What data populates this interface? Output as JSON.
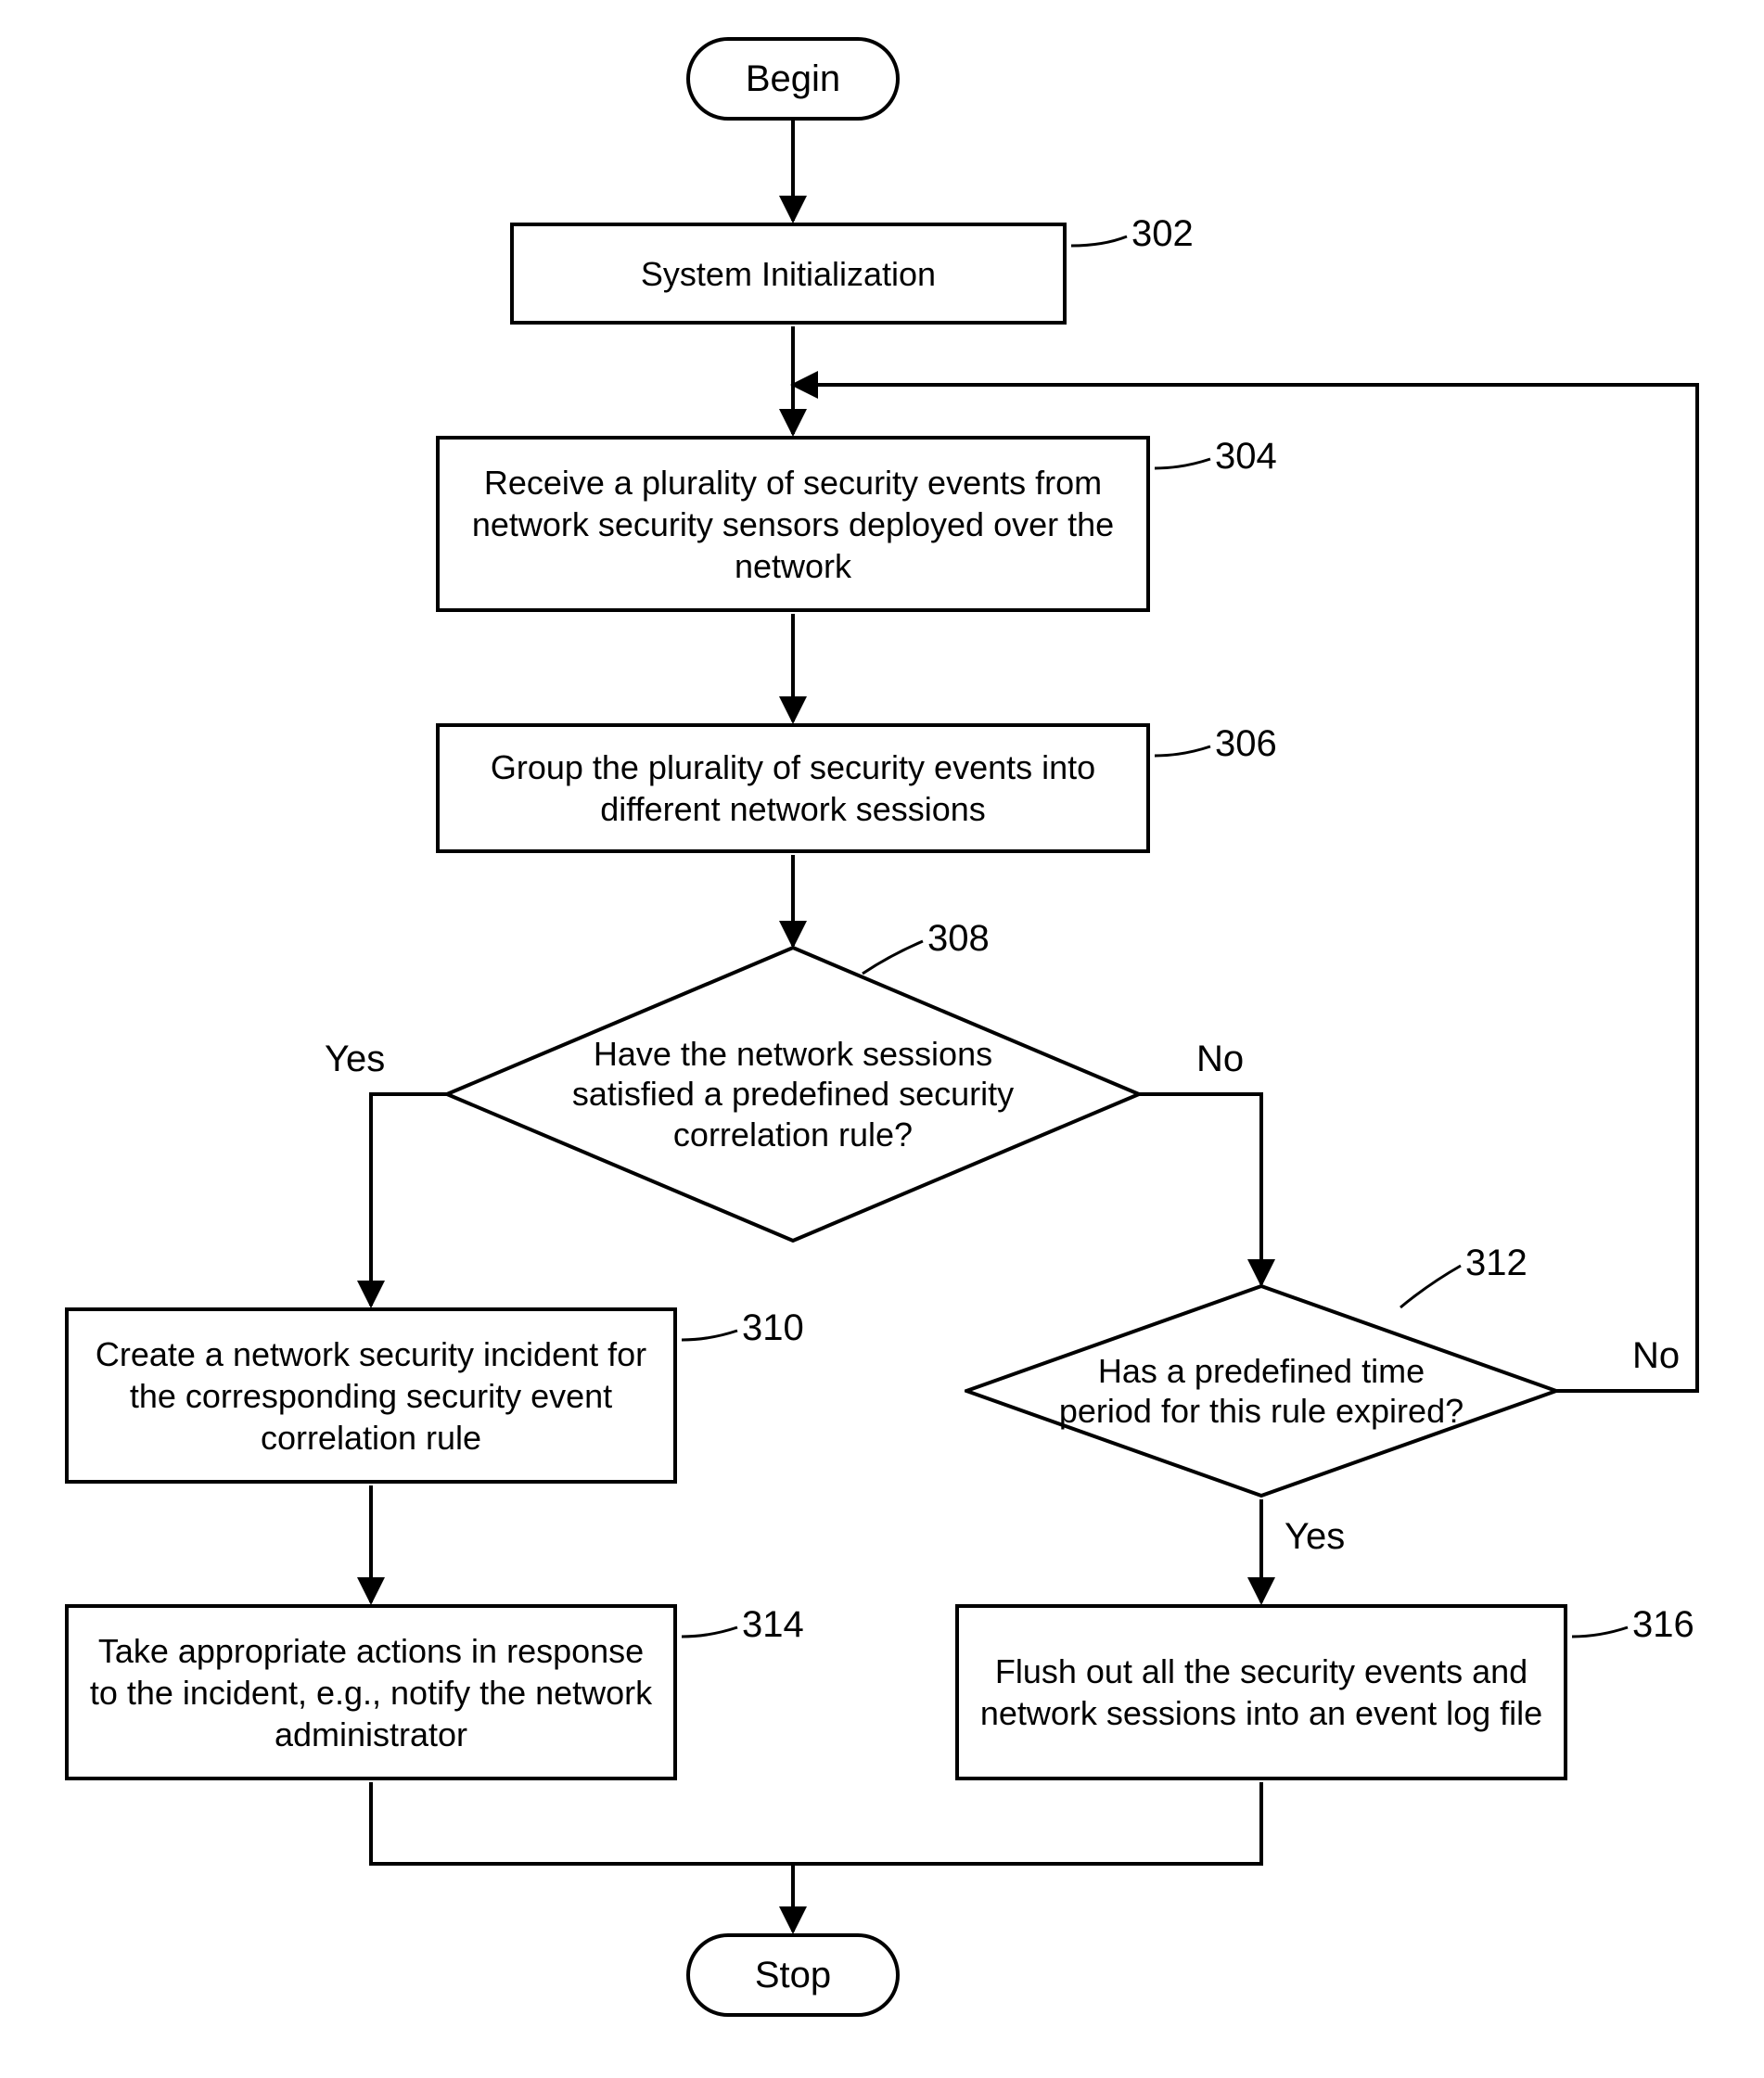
{
  "terminals": {
    "begin": "Begin",
    "stop": "Stop"
  },
  "steps": {
    "s302": "System Initialization",
    "s304": "Receive a plurality of security events from network security sensors deployed over the network",
    "s306": "Group the plurality of security events into different network sessions",
    "s310": "Create a network security incident for the corresponding security event correlation rule",
    "s314": "Take appropriate actions in response to the incident, e.g., notify the network administrator",
    "s316": "Flush out all the security events and network sessions into an event log file"
  },
  "decisions": {
    "d308": "Have the network sessions satisfied a predefined security correlation rule?",
    "d312": "Has a predefined time period for this rule expired?"
  },
  "refs": {
    "r302": "302",
    "r304": "304",
    "r306": "306",
    "r308": "308",
    "r310": "310",
    "r312": "312",
    "r314": "314",
    "r316": "316"
  },
  "labels": {
    "yes": "Yes",
    "no": "No"
  }
}
